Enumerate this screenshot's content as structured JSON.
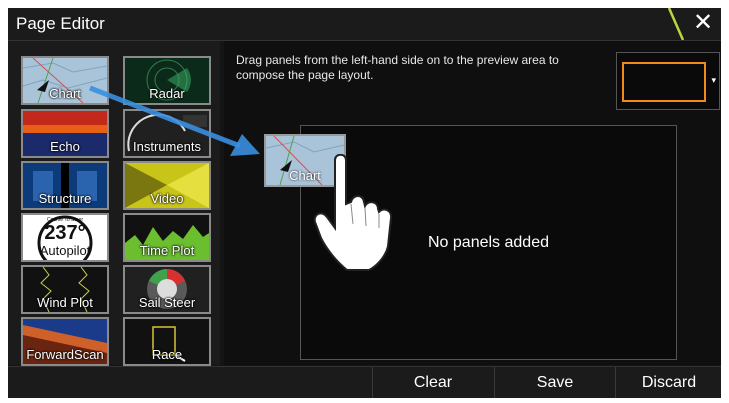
{
  "window": {
    "title": "Page Editor"
  },
  "panels": [
    {
      "label": "Chart",
      "icon": "chart-panel-icon"
    },
    {
      "label": "Radar",
      "icon": "radar-panel-icon"
    },
    {
      "label": "Echo",
      "icon": "echo-panel-icon"
    },
    {
      "label": "Instruments",
      "icon": "instruments-panel-icon"
    },
    {
      "label": "Structure",
      "icon": "structure-panel-icon"
    },
    {
      "label": "Video",
      "icon": "video-panel-icon"
    },
    {
      "label": "Autopilot",
      "icon": "autopilot-panel-icon",
      "heading_caption": "Course To Steer",
      "heading_value": "237°"
    },
    {
      "label": "Time Plot",
      "icon": "timeplot-panel-icon"
    },
    {
      "label": "Wind Plot",
      "icon": "windplot-panel-icon"
    },
    {
      "label": "Sail Steer",
      "icon": "sailsteer-panel-icon"
    },
    {
      "label": "ForwardScan",
      "icon": "forwardscan-panel-icon"
    },
    {
      "label": "Race",
      "icon": "race-panel-icon"
    }
  ],
  "instructions": "Drag panels from the left-hand side on to the preview area to compose the page layout.",
  "preview": {
    "empty_text": "No panels added",
    "dragged_label": "Chart"
  },
  "buttons": {
    "clear": "Clear",
    "save": "Save",
    "discard": "Discard"
  },
  "colors": {
    "accent": "#f28a1a",
    "arrow": "#3a8fe0",
    "background": "#141414"
  }
}
